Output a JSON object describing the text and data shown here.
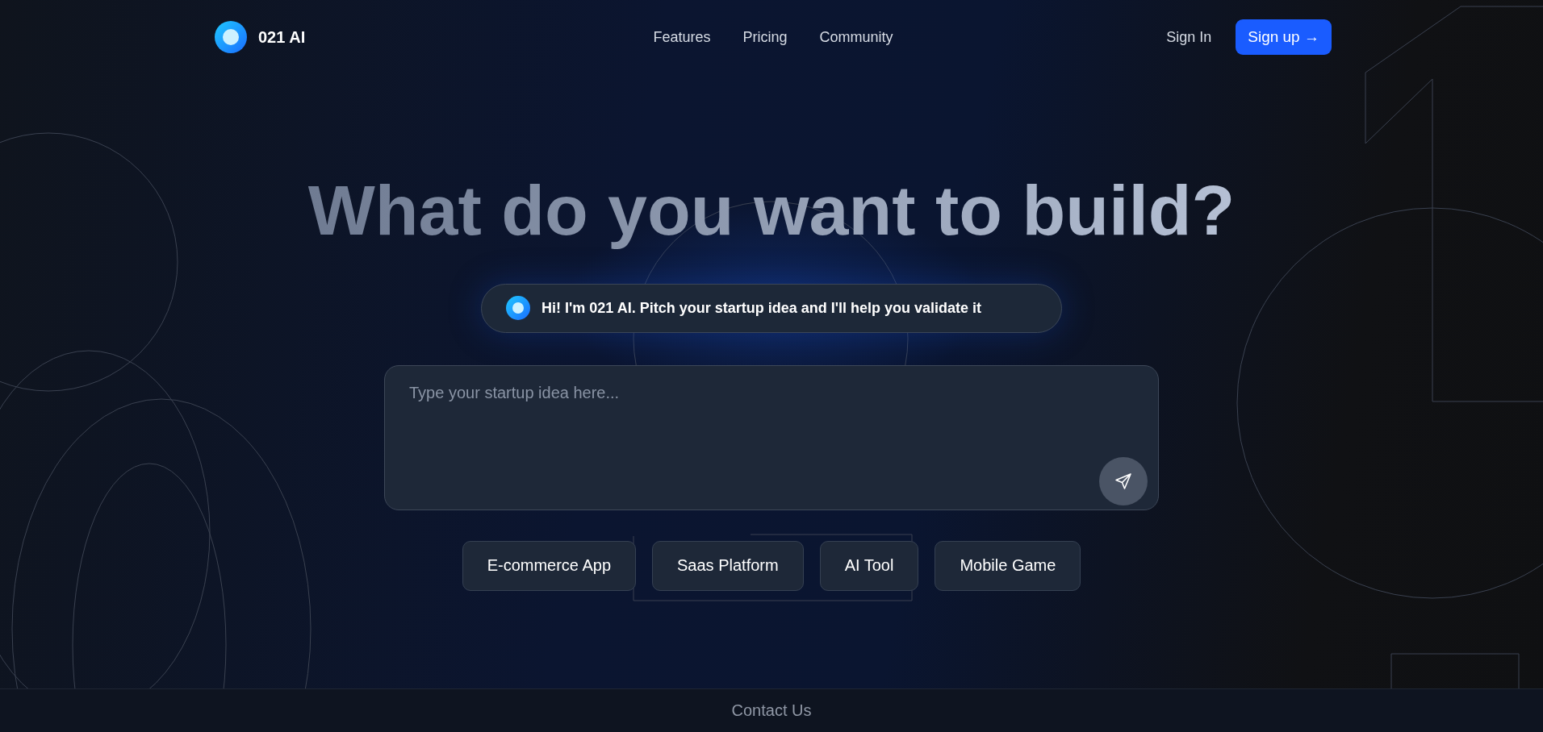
{
  "brand": {
    "name": "021 AI"
  },
  "nav": [
    "Features",
    "Pricing",
    "Community"
  ],
  "auth": {
    "sign_in": "Sign In",
    "sign_up": "Sign up →"
  },
  "headline": "What do you want to build?",
  "greeting": "Hi! I'm 021 AI. Pitch your startup idea and I'll help you validate it",
  "prompt": {
    "placeholder": "Type your startup idea here..."
  },
  "suggestions": [
    "E-commerce App",
    "Saas Platform",
    "AI Tool",
    "Mobile Game"
  ],
  "footer": {
    "link": "Contact Us"
  }
}
